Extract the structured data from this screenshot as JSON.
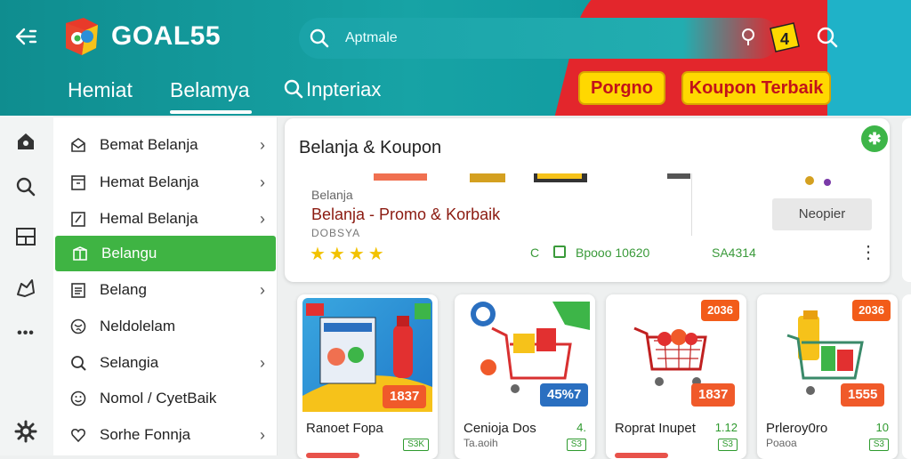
{
  "header": {
    "brand": "GOAL55",
    "search_placeholder": "Aptmale",
    "tabs": [
      "Hemiat",
      "Belamya",
      "Inpteriax"
    ],
    "active_tab": "Belamya",
    "pills": [
      "Porgno",
      "Koupon Terbaik"
    ],
    "ticket_number": "4"
  },
  "rail": {
    "icons": [
      "home-icon",
      "search-icon",
      "layout-icon",
      "map-icon",
      "more-icon",
      "settings-icon"
    ],
    "more_glyph": "•••"
  },
  "sidebar": {
    "items": [
      {
        "label": "Bemat Belanja",
        "icon": "envelope-icon",
        "chevron": true
      },
      {
        "label": "Hemat Belanja",
        "icon": "ticket-icon",
        "chevron": true
      },
      {
        "label": "Hemal Belanja",
        "icon": "edit-icon",
        "chevron": true
      },
      {
        "label": "Belangu",
        "icon": "box-icon",
        "chevron": false,
        "active": true
      },
      {
        "label": "Belang",
        "icon": "list-icon",
        "chevron": true
      },
      {
        "label": "Neldolelam",
        "icon": "globe-icon",
        "chevron": false
      },
      {
        "label": "Selangia",
        "icon": "search-icon",
        "chevron": true
      },
      {
        "label": "Nomol / CyetBaik",
        "icon": "smile-icon",
        "chevron": false
      },
      {
        "label": "Sorhe Fonnja",
        "icon": "heart-icon",
        "chevron": true
      }
    ],
    "chevron_glyph": "›"
  },
  "main": {
    "title": "Belanja & Koupon",
    "badge_glyph": "✱",
    "small_label": "Belanja",
    "promo_title": "Belanja - Promo & Korbaik",
    "sub_label": "DOBSYA",
    "stars": "★★★★",
    "button": "Neopier",
    "meta_1": "C",
    "meta_2": "Bpooo 10620",
    "meta_3": "SA4314",
    "kebab": "⋮"
  },
  "products": [
    {
      "name": "Ranoet Fopa",
      "price_tag": "1837",
      "top_tag": "",
      "badge": "S3K",
      "sub": ""
    },
    {
      "name": "Cenioja Dos",
      "price_tag": "45%7",
      "top_tag": "",
      "badge": "S3",
      "sub": "Ta.aoih",
      "small": "4."
    },
    {
      "name": "Roprat Inupet",
      "price_tag": "1837",
      "top_tag": "2036",
      "badge": "S3",
      "sub": "",
      "small": "1.12"
    },
    {
      "name": "Prleroy0ro",
      "price_tag": "1555",
      "top_tag": "2036",
      "badge": "S3",
      "sub": "Poaoa",
      "small": "10"
    }
  ],
  "colors": {
    "header": "#139ea2",
    "accent_red": "#e3262c",
    "accent_green": "#3fb443",
    "pill_yellow": "#ffd800"
  }
}
